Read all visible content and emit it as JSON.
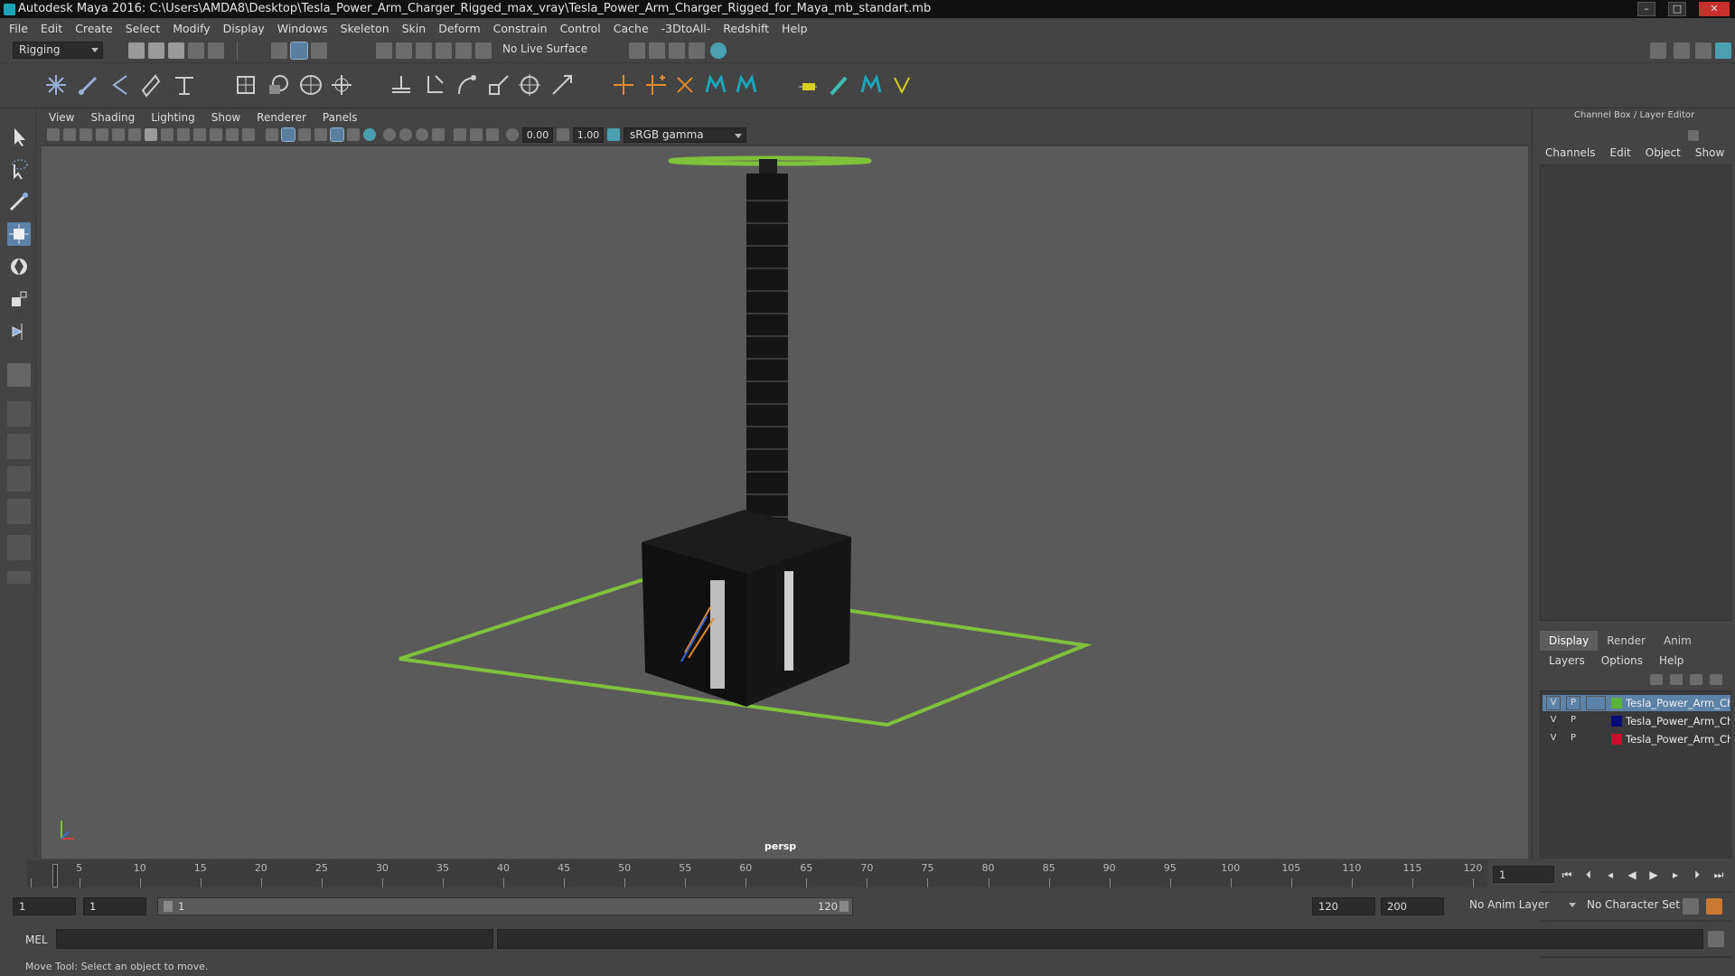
{
  "window": {
    "title": "Autodesk Maya 2016: C:\\Users\\AMDA8\\Desktop\\Tesla_Power_Arm_Charger_Rigged_max_vray\\Tesla_Power_Arm_Charger_Rigged_for_Maya_mb_standart.mb",
    "min": "–",
    "max": "□",
    "close": "✕"
  },
  "menubar": [
    "File",
    "Edit",
    "Create",
    "Select",
    "Modify",
    "Display",
    "Windows",
    "Skeleton",
    "Skin",
    "Deform",
    "Constrain",
    "Control",
    "Cache",
    "-3DtoAll-",
    "Redshift",
    "Help"
  ],
  "toolbar": {
    "menuset": "Rigging",
    "live_surface": "No Live Surface"
  },
  "viewport": {
    "menu": [
      "View",
      "Shading",
      "Lighting",
      "Show",
      "Renderer",
      "Panels"
    ],
    "exposure": "0.00",
    "gamma": "1.00",
    "colorspace": "sRGB gamma",
    "camera_label": "persp"
  },
  "channel_box": {
    "title": "Channel Box / Layer Editor",
    "menu": [
      "Channels",
      "Edit",
      "Object",
      "Show"
    ]
  },
  "layer_editor": {
    "tabs": [
      "Display",
      "Render",
      "Anim"
    ],
    "menu": [
      "Layers",
      "Options",
      "Help"
    ],
    "layers": [
      {
        "v": "V",
        "p": "P",
        "color": "#5ab43c",
        "name": "Tesla_Power_Arm_Char",
        "selected": true
      },
      {
        "v": "V",
        "p": "P",
        "color": "#0a0a7a",
        "name": "Tesla_Power_Arm_Char",
        "selected": false
      },
      {
        "v": "V",
        "p": "P",
        "color": "#c8102e",
        "name": "Tesla_Power_Arm_Char",
        "selected": false
      }
    ]
  },
  "timeline": {
    "ticks": [
      "1",
      "5",
      "10",
      "15",
      "20",
      "25",
      "30",
      "35",
      "40",
      "45",
      "50",
      "55",
      "60",
      "65",
      "70",
      "75",
      "80",
      "85",
      "90",
      "95",
      "100",
      "105",
      "110",
      "115",
      "120"
    ],
    "current_frame": "1"
  },
  "range": {
    "start": "1",
    "playback_start": "1",
    "slider_start": "1",
    "slider_end": "120",
    "playback_end": "120",
    "end": "200",
    "anim_layer": "No Anim Layer",
    "character_set": "No Character Set"
  },
  "command": {
    "mel_label": "MEL",
    "help_line": "Move Tool: Select an object to move."
  },
  "colors": {
    "bg": "#444444",
    "viewport": "#5a5a5a",
    "accent": "#5ab43c",
    "selection": "#5d82a8"
  }
}
